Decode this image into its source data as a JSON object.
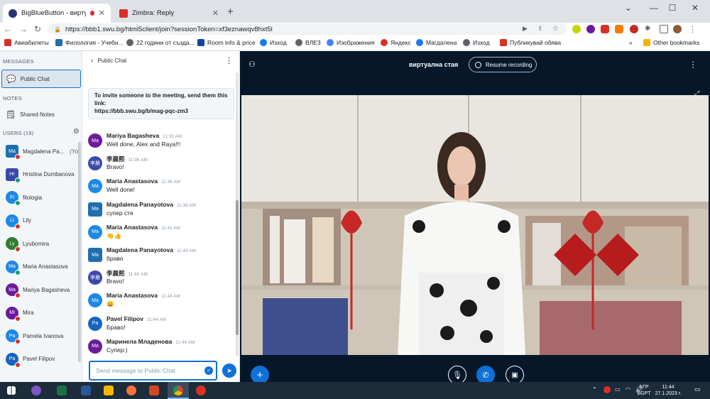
{
  "browser": {
    "tabs": [
      {
        "title": "BigBlueButton - виртуална с",
        "active": true
      },
      {
        "title": "Zimbra: Reply",
        "active": false
      }
    ],
    "url": "https://bbb1.swu.bg/html5client/join?sessionToken=xf3eznawqv8hxt5l",
    "bookmarks": [
      "Авиабилеты",
      "Филология - Учебн...",
      "22 години от създа...",
      "Room info & price",
      "Изход",
      "ВЛЕЗ",
      "Изображения",
      "Яндекс",
      "Магдалена",
      "Изход",
      "Публикувай обява"
    ],
    "other_bookmarks": "Other bookmarks"
  },
  "sidebar": {
    "messages_header": "MESSAGES",
    "public_chat": "Public Chat",
    "notes_header": "NOTES",
    "shared_notes": "Shared Notes",
    "users_header": "USERS (19)",
    "users": [
      {
        "initials": "Ma",
        "name": "Magdalena Pa...",
        "you": "(You)",
        "color": "#1e6fb0",
        "square": true,
        "status": "#d93025"
      },
      {
        "initials": "Hr",
        "name": "Hristina Dumbanova",
        "color": "#3949ab",
        "square": true,
        "status": "#0e9f6e"
      },
      {
        "initials": "Fi",
        "name": "filologia",
        "color": "#1e88e5",
        "square": false,
        "status": "#0e9f6e"
      },
      {
        "initials": "Li",
        "name": "Lily",
        "color": "#1e88e5",
        "square": false,
        "status": "#d93025"
      },
      {
        "initials": "Ly",
        "name": "Lyubomira",
        "color": "#2e7d32",
        "square": false,
        "status": "#d93025"
      },
      {
        "initials": "Ma",
        "name": "Maria Anastasova",
        "color": "#1e88e5",
        "square": false,
        "status": "#0e9f6e"
      },
      {
        "initials": "Ma",
        "name": "Mariya Bagasheva",
        "color": "#6a1b9a",
        "square": false,
        "status": "#d93025"
      },
      {
        "initials": "Mi",
        "name": "Mira",
        "color": "#6a1b9a",
        "square": false,
        "status": "#d93025"
      },
      {
        "initials": "Pa",
        "name": "Pamela Ivanova",
        "color": "#1e88e5",
        "square": false,
        "status": "#d93025"
      },
      {
        "initials": "Pa",
        "name": "Pavel Filipov",
        "color": "#1565c0",
        "square": false,
        "status": "#d93025"
      }
    ]
  },
  "chat": {
    "title": "Public Chat",
    "invite_text": "To invite someone to the meeting, send them this link:",
    "invite_link": "https://bbb.swu.bg/b/mag-pqc-zm3",
    "messages": [
      {
        "initials": "Ma",
        "color": "#6a1b9a",
        "square": false,
        "name": "Mariya Bagasheva",
        "time": "11:35 AM",
        "text": "Well done, Alex and Raya!!!"
      },
      {
        "initials": "李晨",
        "color": "#3949ab",
        "square": false,
        "name": "李晨熙",
        "time": "11:36 AM",
        "text": "Bravo!"
      },
      {
        "initials": "Ma",
        "color": "#1e88e5",
        "square": false,
        "name": "Maria Anastasova",
        "time": "11:36 AM",
        "text": "Well done!"
      },
      {
        "initials": "Ma",
        "color": "#1e6fb0",
        "square": true,
        "name": "Magdalena Panayotova",
        "time": "11:38 AM",
        "text": "супер сте"
      },
      {
        "initials": "Ma",
        "color": "#1e88e5",
        "square": false,
        "name": "Maria Anastasova",
        "time": "11:41 AM",
        "text": "👏👍"
      },
      {
        "initials": "Ma",
        "color": "#1e6fb0",
        "square": true,
        "name": "Magdalena Panayotova",
        "time": "11:44 AM",
        "text": "браво"
      },
      {
        "initials": "李晨",
        "color": "#3949ab",
        "square": false,
        "name": "李晨熙",
        "time": "11:44 AM",
        "text": "Bravo!"
      },
      {
        "initials": "Ma",
        "color": "#1e88e5",
        "square": false,
        "name": "Maria Anastasova",
        "time": "11:44 AM",
        "text": "😀"
      },
      {
        "initials": "Pa",
        "color": "#1565c0",
        "square": false,
        "name": "Pavel Filipov",
        "time": "11:44 AM",
        "text": "Браво!"
      },
      {
        "initials": "Ma",
        "color": "#6a1b9a",
        "square": false,
        "name": "Маринела Младенова",
        "time": "11:44 AM",
        "text": "Супер:)"
      }
    ],
    "input_placeholder": "Send message to Public Chat"
  },
  "main": {
    "room_title": "виртуална стая",
    "resume_recording": "Resume recording"
  },
  "taskbar": {
    "lang1": "БГР",
    "lang2": "BGPT",
    "time": "11:44",
    "date": "27.1.2023 г."
  }
}
